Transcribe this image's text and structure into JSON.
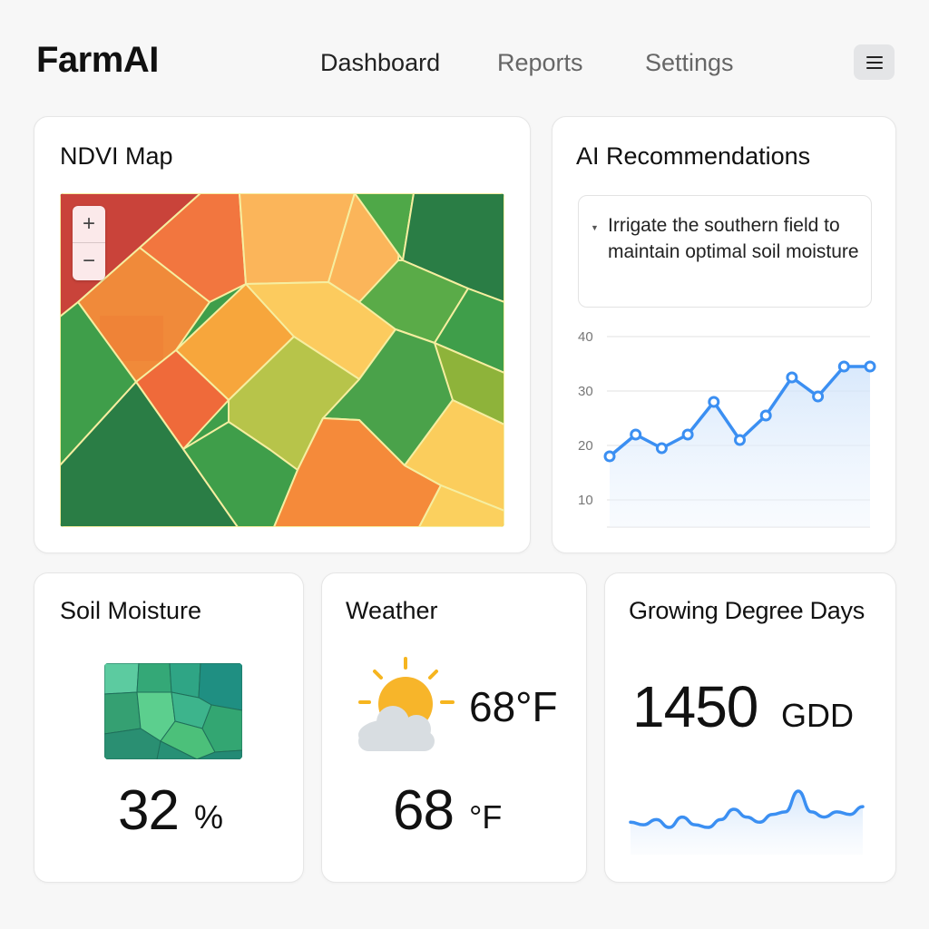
{
  "app": {
    "brand": "FarmAI",
    "nav": [
      "Dashboard",
      "Reports",
      "Settings"
    ],
    "menu_icon": "hamburger-menu-icon"
  },
  "ndvi": {
    "title": "NDVI Map",
    "zoom_in": "+",
    "zoom_out": "−",
    "colors": [
      "#c9433a",
      "#f2763f",
      "#f7a63c",
      "#fbc85a",
      "#b7c44a",
      "#8eb33a",
      "#5aab48",
      "#3f9e4a",
      "#2a7d45"
    ]
  },
  "ai_recommendations": {
    "title": "AI Recommendations",
    "text": "Irrigate the southern field to maintain optimal soil moisture",
    "chart_data": {
      "type": "line",
      "x": [
        1,
        2,
        3,
        4,
        5,
        6,
        7,
        8,
        9,
        10,
        11
      ],
      "values": [
        18,
        22,
        19.5,
        22,
        28,
        21,
        25.5,
        32.5,
        29,
        34.5,
        34.5
      ],
      "y_ticks": [
        10,
        20,
        30,
        40
      ],
      "ylim": [
        5,
        40
      ],
      "grid": true,
      "line_color": "#3b8ff2"
    }
  },
  "soil_moisture": {
    "title": "Soil Moisture",
    "value": "32",
    "unit": "%"
  },
  "weather": {
    "title": "Weather",
    "temp_small": "68°F",
    "value": "68",
    "unit": "°F",
    "icon": "partly-cloudy-icon"
  },
  "gdd": {
    "title": "Growing Degree Days",
    "value": "1450",
    "unit": "GDD",
    "chart_data": {
      "type": "area",
      "values": [
        7,
        6,
        8,
        5,
        9,
        6,
        5,
        8,
        12,
        9,
        7,
        10,
        11,
        19,
        11,
        9,
        11,
        10,
        13
      ]
    }
  }
}
